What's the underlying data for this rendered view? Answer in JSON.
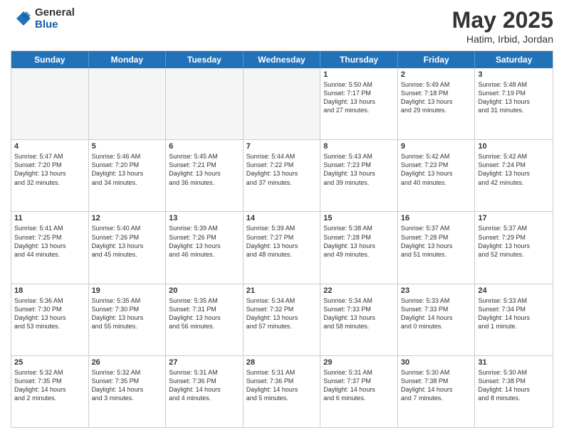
{
  "logo": {
    "general": "General",
    "blue": "Blue"
  },
  "title": "May 2025",
  "subtitle": "Hatim, Irbid, Jordan",
  "header_days": [
    "Sunday",
    "Monday",
    "Tuesday",
    "Wednesday",
    "Thursday",
    "Friday",
    "Saturday"
  ],
  "weeks": [
    [
      {
        "day": "",
        "info": ""
      },
      {
        "day": "",
        "info": ""
      },
      {
        "day": "",
        "info": ""
      },
      {
        "day": "",
        "info": ""
      },
      {
        "day": "1",
        "info": "Sunrise: 5:50 AM\nSunset: 7:17 PM\nDaylight: 13 hours\nand 27 minutes."
      },
      {
        "day": "2",
        "info": "Sunrise: 5:49 AM\nSunset: 7:18 PM\nDaylight: 13 hours\nand 29 minutes."
      },
      {
        "day": "3",
        "info": "Sunrise: 5:48 AM\nSunset: 7:19 PM\nDaylight: 13 hours\nand 31 minutes."
      }
    ],
    [
      {
        "day": "4",
        "info": "Sunrise: 5:47 AM\nSunset: 7:20 PM\nDaylight: 13 hours\nand 32 minutes."
      },
      {
        "day": "5",
        "info": "Sunrise: 5:46 AM\nSunset: 7:20 PM\nDaylight: 13 hours\nand 34 minutes."
      },
      {
        "day": "6",
        "info": "Sunrise: 5:45 AM\nSunset: 7:21 PM\nDaylight: 13 hours\nand 36 minutes."
      },
      {
        "day": "7",
        "info": "Sunrise: 5:44 AM\nSunset: 7:22 PM\nDaylight: 13 hours\nand 37 minutes."
      },
      {
        "day": "8",
        "info": "Sunrise: 5:43 AM\nSunset: 7:23 PM\nDaylight: 13 hours\nand 39 minutes."
      },
      {
        "day": "9",
        "info": "Sunrise: 5:42 AM\nSunset: 7:23 PM\nDaylight: 13 hours\nand 40 minutes."
      },
      {
        "day": "10",
        "info": "Sunrise: 5:42 AM\nSunset: 7:24 PM\nDaylight: 13 hours\nand 42 minutes."
      }
    ],
    [
      {
        "day": "11",
        "info": "Sunrise: 5:41 AM\nSunset: 7:25 PM\nDaylight: 13 hours\nand 44 minutes."
      },
      {
        "day": "12",
        "info": "Sunrise: 5:40 AM\nSunset: 7:26 PM\nDaylight: 13 hours\nand 45 minutes."
      },
      {
        "day": "13",
        "info": "Sunrise: 5:39 AM\nSunset: 7:26 PM\nDaylight: 13 hours\nand 46 minutes."
      },
      {
        "day": "14",
        "info": "Sunrise: 5:39 AM\nSunset: 7:27 PM\nDaylight: 13 hours\nand 48 minutes."
      },
      {
        "day": "15",
        "info": "Sunrise: 5:38 AM\nSunset: 7:28 PM\nDaylight: 13 hours\nand 49 minutes."
      },
      {
        "day": "16",
        "info": "Sunrise: 5:37 AM\nSunset: 7:28 PM\nDaylight: 13 hours\nand 51 minutes."
      },
      {
        "day": "17",
        "info": "Sunrise: 5:37 AM\nSunset: 7:29 PM\nDaylight: 13 hours\nand 52 minutes."
      }
    ],
    [
      {
        "day": "18",
        "info": "Sunrise: 5:36 AM\nSunset: 7:30 PM\nDaylight: 13 hours\nand 53 minutes."
      },
      {
        "day": "19",
        "info": "Sunrise: 5:35 AM\nSunset: 7:30 PM\nDaylight: 13 hours\nand 55 minutes."
      },
      {
        "day": "20",
        "info": "Sunrise: 5:35 AM\nSunset: 7:31 PM\nDaylight: 13 hours\nand 56 minutes."
      },
      {
        "day": "21",
        "info": "Sunrise: 5:34 AM\nSunset: 7:32 PM\nDaylight: 13 hours\nand 57 minutes."
      },
      {
        "day": "22",
        "info": "Sunrise: 5:34 AM\nSunset: 7:33 PM\nDaylight: 13 hours\nand 58 minutes."
      },
      {
        "day": "23",
        "info": "Sunrise: 5:33 AM\nSunset: 7:33 PM\nDaylight: 14 hours\nand 0 minutes."
      },
      {
        "day": "24",
        "info": "Sunrise: 5:33 AM\nSunset: 7:34 PM\nDaylight: 14 hours\nand 1 minute."
      }
    ],
    [
      {
        "day": "25",
        "info": "Sunrise: 5:32 AM\nSunset: 7:35 PM\nDaylight: 14 hours\nand 2 minutes."
      },
      {
        "day": "26",
        "info": "Sunrise: 5:32 AM\nSunset: 7:35 PM\nDaylight: 14 hours\nand 3 minutes."
      },
      {
        "day": "27",
        "info": "Sunrise: 5:31 AM\nSunset: 7:36 PM\nDaylight: 14 hours\nand 4 minutes."
      },
      {
        "day": "28",
        "info": "Sunrise: 5:31 AM\nSunset: 7:36 PM\nDaylight: 14 hours\nand 5 minutes."
      },
      {
        "day": "29",
        "info": "Sunrise: 5:31 AM\nSunset: 7:37 PM\nDaylight: 14 hours\nand 6 minutes."
      },
      {
        "day": "30",
        "info": "Sunrise: 5:30 AM\nSunset: 7:38 PM\nDaylight: 14 hours\nand 7 minutes."
      },
      {
        "day": "31",
        "info": "Sunrise: 5:30 AM\nSunset: 7:38 PM\nDaylight: 14 hours\nand 8 minutes."
      }
    ]
  ]
}
